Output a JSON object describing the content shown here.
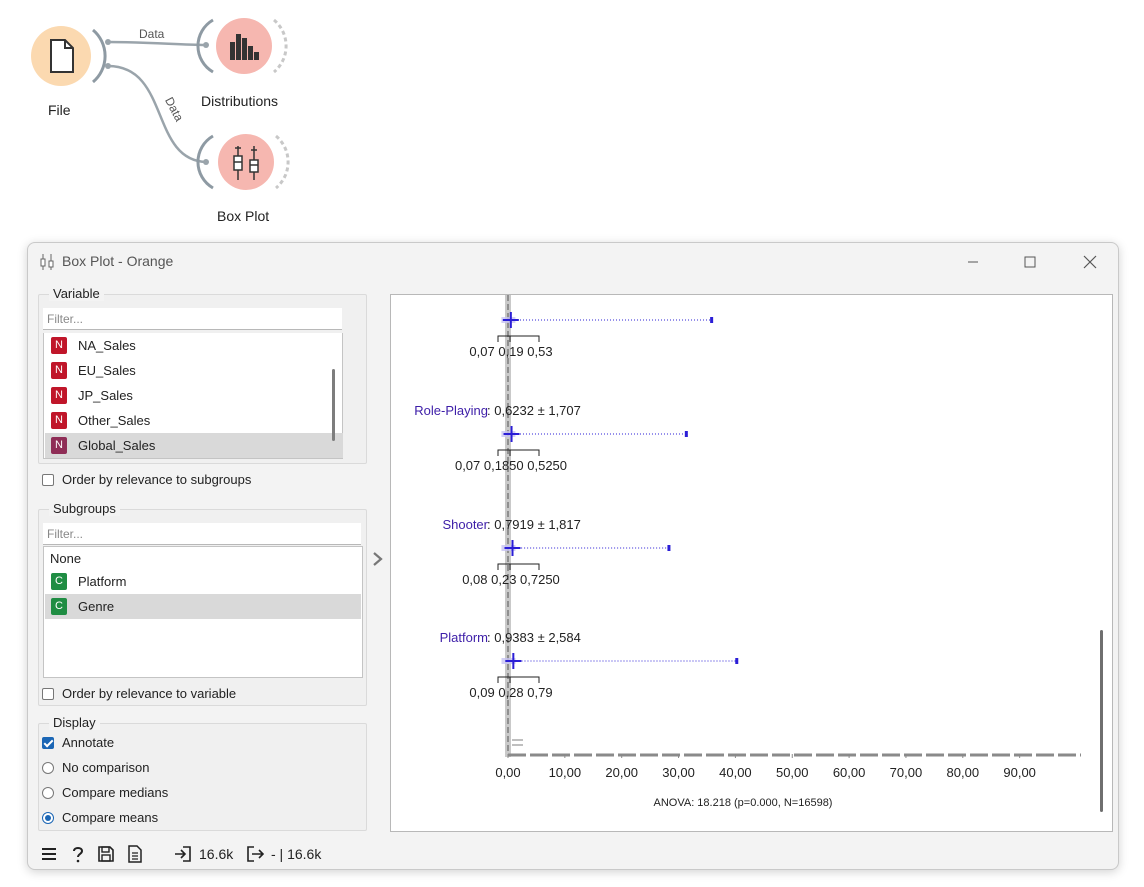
{
  "workflow": {
    "nodes": {
      "file": "File",
      "distributions": "Distributions",
      "box_plot": "Box Plot"
    },
    "links": {
      "file_to_distributions": "Data",
      "file_to_box_plot": "Data"
    }
  },
  "window": {
    "title": "Box Plot - Orange"
  },
  "variable": {
    "title": "Variable",
    "filter_placeholder": "Filter...",
    "items": [
      {
        "type": "N",
        "label": "NA_Sales"
      },
      {
        "type": "N",
        "label": "EU_Sales"
      },
      {
        "type": "N",
        "label": "JP_Sales"
      },
      {
        "type": "N",
        "label": "Other_Sales"
      },
      {
        "type": "N",
        "label": "Global_Sales",
        "selected": true
      }
    ],
    "order_by_relevance": "Order by relevance to subgroups"
  },
  "subgroups": {
    "title": "Subgroups",
    "filter_placeholder": "Filter...",
    "items": [
      {
        "type": "",
        "label": "None"
      },
      {
        "type": "C",
        "label": "Platform"
      },
      {
        "type": "C",
        "label": "Genre",
        "selected": true
      }
    ],
    "order_by_relevance": "Order by relevance to variable"
  },
  "display": {
    "title": "Display",
    "annotate": "Annotate",
    "annotate_checked": true,
    "options": [
      "No comparison",
      "Compare medians",
      "Compare means"
    ],
    "selected": "Compare means"
  },
  "statusbar": {
    "input_count": "16.6k",
    "output_count": "- | 16.6k"
  },
  "chart_data": {
    "type": "box",
    "xlim": [
      0,
      100
    ],
    "xticks": [
      "0,00",
      "10,00",
      "20,00",
      "30,00",
      "40,00",
      "50,00",
      "60,00",
      "70,00",
      "80,00",
      "90,00"
    ],
    "groups": [
      {
        "name": "",
        "stat_label": "",
        "mean": 0.5,
        "q1": 0.07,
        "median": 0.19,
        "q3": 0.53,
        "max": 35.82,
        "quartile_labels": [
          "0,07",
          "0,19",
          "0,53"
        ]
      },
      {
        "name": "Role-Playing",
        "stat_label": ": 0,6232 ± 1,707",
        "mean": 0.6232,
        "q1": 0.07,
        "median": 0.185,
        "q3": 0.525,
        "max": 31.37,
        "quartile_labels": [
          "0,07",
          "0,1850",
          "0,5250"
        ]
      },
      {
        "name": "Shooter",
        "stat_label": ": 0,7919 ± 1,817",
        "mean": 0.7919,
        "q1": 0.08,
        "median": 0.23,
        "q3": 0.725,
        "max": 28.31,
        "quartile_labels": [
          "0,08",
          "0,23",
          "0,7250"
        ]
      },
      {
        "name": "Platform",
        "stat_label": ": 0,9383 ± 2,584",
        "mean": 0.9383,
        "q1": 0.09,
        "median": 0.28,
        "q3": 0.79,
        "max": 40.24,
        "quartile_labels": [
          "0,09",
          "0,28",
          "0,79"
        ]
      }
    ],
    "footer": "ANOVA: 18.218 (p=0.000, N=16598)",
    "colors": {
      "group_label": "#3d1ea8",
      "box": "#2b1ed6",
      "axis": "#8a8a8a"
    }
  }
}
